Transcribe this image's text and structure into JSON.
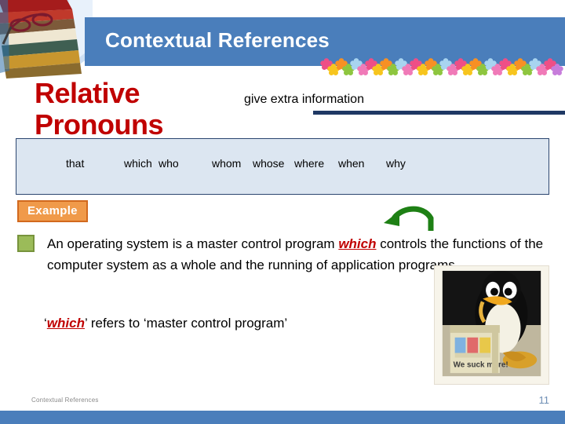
{
  "slide": {
    "header_title": "Contextual References",
    "main_title": "Relative Pronouns",
    "subtitle": "give extra information",
    "pronouns": {
      "that": "that",
      "which": "which",
      "who": "who",
      "whom": "whom",
      "whose": "whose",
      "where": "where",
      "when": "when",
      "why": "why"
    },
    "example_label": "Example",
    "body": {
      "part1": "An operating system is a master control program ",
      "keyword": "which",
      "part2": " controls the functions of the computer system as a whole and the running of application programs."
    },
    "refers": {
      "open_quote": "‘",
      "keyword": "which",
      "rest": "’ refers to ‘master control program’"
    },
    "footer": {
      "label": "Contextual References",
      "page": "11"
    },
    "icons": {
      "books": "stack-of-books-image",
      "flowers": "flower-border-decoration",
      "arrow": "curved-green-arrow-icon",
      "bullet": "green-square-bullet-icon",
      "penguin": "tux-penguin-photo"
    },
    "colors": {
      "header_blue": "#4a7ebb",
      "title_red": "#c00000",
      "box_fill": "#dce6f1",
      "box_border": "#2c4670",
      "badge_orange": "#f09a4a",
      "badge_border": "#d2691e",
      "bullet_green": "#9bbb59",
      "arrow_green": "#1e8015",
      "navy_rule": "#1f3864"
    }
  }
}
